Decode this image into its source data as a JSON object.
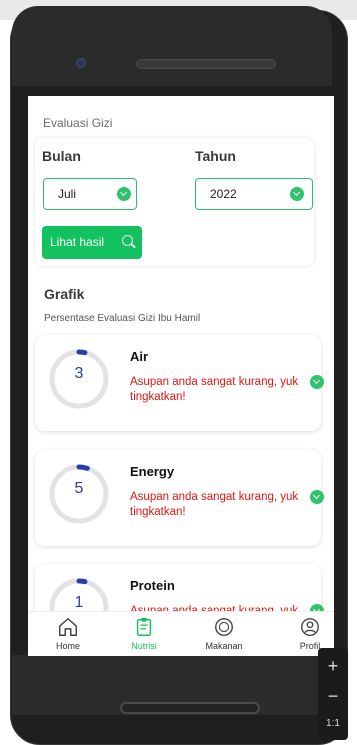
{
  "header": {
    "title": "Evaluasi Gizi"
  },
  "filters": {
    "month_label": "Bulan",
    "month_value": "Juli",
    "year_label": "Tahun",
    "year_value": "2022",
    "submit_label": "Lihat hasil"
  },
  "chart_section": {
    "title": "Grafik",
    "subtitle": "Persentase Evaluasi Gizi Ibu Hamil"
  },
  "nutrients": [
    {
      "name": "Air",
      "value": "3",
      "percent": 3,
      "message": "Asupan anda sangat kurang, yuk tingkatkan!"
    },
    {
      "name": "Energy",
      "value": "5",
      "percent": 5,
      "message": "Asupan anda sangat kurang, yuk tingkatkan!"
    },
    {
      "name": "Protein",
      "value": "1",
      "percent": 1,
      "message": "Asupan anda sangat kurang, yuk tingkatkan!"
    }
  ],
  "bottom_nav": [
    {
      "label": "Home",
      "icon": "home-icon",
      "active": false
    },
    {
      "label": "Nutrisi",
      "icon": "clipboard-icon",
      "active": true
    },
    {
      "label": "Makanan",
      "icon": "plate-icon",
      "active": false
    },
    {
      "label": "Profil",
      "icon": "profile-icon",
      "active": false
    }
  ],
  "zoom_controls": {
    "plus": "+",
    "minus": "−",
    "ratio": "1:1"
  },
  "colors": {
    "accent": "#12c25f",
    "warning": "#e01515",
    "ring": "#2b3ea8"
  }
}
